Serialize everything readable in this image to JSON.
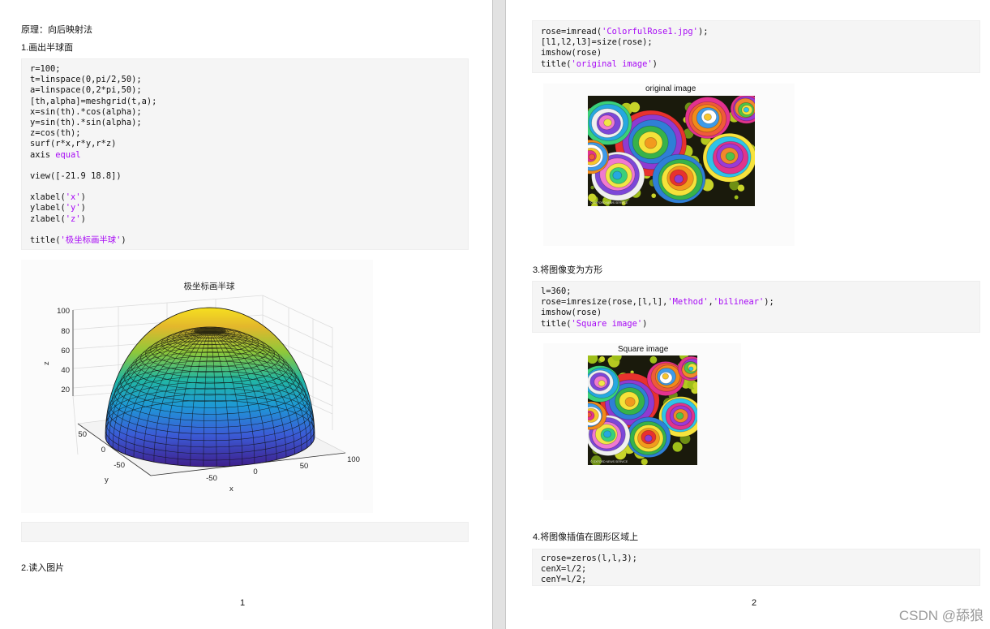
{
  "page1": {
    "heading": "原理：向后映射法",
    "section1": {
      "num": "1.",
      "title": "画出半球面"
    },
    "code1": [
      [
        {
          "t": "r=100;"
        }
      ],
      [
        {
          "t": "t=linspace(0,pi/2,50);"
        }
      ],
      [
        {
          "t": "a=linspace(0,2*pi,50);"
        }
      ],
      [
        {
          "t": "[th,alpha]=meshgrid(t,a);"
        }
      ],
      [
        {
          "t": "x=sin(th).*cos(alpha);"
        }
      ],
      [
        {
          "t": "y=sin(th).*sin(alpha);"
        }
      ],
      [
        {
          "t": "z=cos(th);"
        }
      ],
      [
        {
          "t": "surf(r*x,r*y,r*z)"
        }
      ],
      [
        {
          "t": "axis "
        },
        {
          "t": "equal",
          "s": 1
        }
      ],
      [
        {
          "t": ""
        }
      ],
      [
        {
          "t": "view([-21.9 18.8])"
        }
      ],
      [
        {
          "t": ""
        }
      ],
      [
        {
          "t": "xlabel("
        },
        {
          "t": "'x'",
          "s": 1
        },
        {
          "t": ")"
        }
      ],
      [
        {
          "t": "ylabel("
        },
        {
          "t": "'y'",
          "s": 1
        },
        {
          "t": ")"
        }
      ],
      [
        {
          "t": "zlabel("
        },
        {
          "t": "'z'",
          "s": 1
        },
        {
          "t": ")"
        }
      ],
      [
        {
          "t": ""
        }
      ],
      [
        {
          "t": "title("
        },
        {
          "t": "'极坐标画半球'",
          "s": 1
        },
        {
          "t": ")"
        }
      ]
    ],
    "plot": {
      "title": "极坐标画半球",
      "zlabel": "z",
      "ylabel": "y",
      "xlabel": "x",
      "zticks": [
        "100",
        "80",
        "60",
        "40",
        "20"
      ],
      "yticks": [
        "50",
        "0",
        "-50"
      ],
      "xticks": [
        "-50",
        "0",
        "50",
        "100"
      ]
    },
    "section2": {
      "num": "2.",
      "title": "读入图片"
    },
    "page_number": "1"
  },
  "page2": {
    "code2": [
      [
        {
          "t": "rose=imread("
        },
        {
          "t": "'ColorfulRose1.jpg'",
          "s": 1
        },
        {
          "t": ");"
        }
      ],
      [
        {
          "t": "[l1,l2,l3]=size(rose);"
        }
      ],
      [
        {
          "t": "imshow(rose)"
        }
      ],
      [
        {
          "t": "title("
        },
        {
          "t": "'original image'",
          "s": 1
        },
        {
          "t": ")"
        }
      ]
    ],
    "image1_title": "original image",
    "image1_caption": "© OXFORD NEWS SERVICE",
    "section3": {
      "num": "3.",
      "title": "将图像变为方形"
    },
    "code3": [
      [
        {
          "t": "l=360;"
        }
      ],
      [
        {
          "t": "rose=imresize(rose,[l,l],"
        },
        {
          "t": "'Method'",
          "s": 1
        },
        {
          "t": ","
        },
        {
          "t": "'bilinear'",
          "s": 1
        },
        {
          "t": ");"
        }
      ],
      [
        {
          "t": "imshow(rose)"
        }
      ],
      [
        {
          "t": "title("
        },
        {
          "t": "'Square image'",
          "s": 1
        },
        {
          "t": ")"
        }
      ]
    ],
    "image2_title": "Square image",
    "image2_caption": "© OXFORD NEWS SERVICE",
    "section4": {
      "num": "4.",
      "title": "将图像插值在圆形区域上"
    },
    "code4": [
      [
        {
          "t": "crose=zeros(l,l,3);"
        }
      ],
      [
        {
          "t": "cenX=l/2;"
        }
      ],
      [
        {
          "t": "cenY=l/2;"
        }
      ]
    ],
    "page_number": "2"
  },
  "watermark": "CSDN @舔狼",
  "colors": {
    "string": "#a709f5",
    "code_bg": "#f5f5f5",
    "page_bg": "#ffffff",
    "gutter": "#e2e2e2"
  }
}
